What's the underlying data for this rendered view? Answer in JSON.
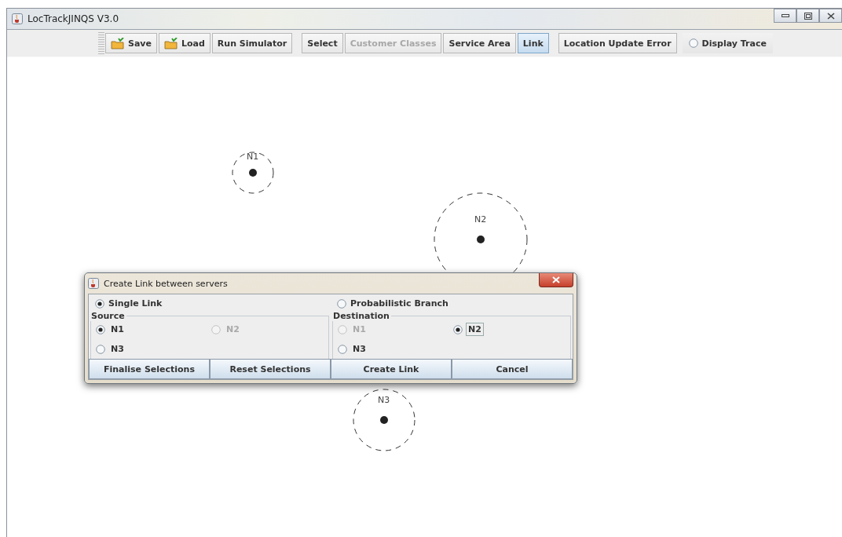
{
  "window": {
    "title": "LocTrackJINQS V3.0"
  },
  "toolbar": [
    {
      "kind": "button",
      "label": "Save",
      "icon": true,
      "selected": false,
      "disabled": false
    },
    {
      "kind": "button",
      "label": "Load",
      "icon": true,
      "selected": false,
      "disabled": false
    },
    {
      "kind": "button",
      "label": "Run Simulator",
      "icon": false,
      "selected": false,
      "disabled": false
    },
    {
      "kind": "separator"
    },
    {
      "kind": "button",
      "label": "Select",
      "icon": false,
      "selected": false,
      "disabled": false
    },
    {
      "kind": "button",
      "label": "Customer Classes",
      "icon": false,
      "selected": false,
      "disabled": true
    },
    {
      "kind": "button",
      "label": "Service Area",
      "icon": false,
      "selected": false,
      "disabled": false
    },
    {
      "kind": "button",
      "label": "Link",
      "icon": false,
      "selected": true,
      "disabled": false
    },
    {
      "kind": "separator"
    },
    {
      "kind": "button",
      "label": "Location Update Error",
      "icon": false,
      "selected": false,
      "disabled": false
    },
    {
      "kind": "radio",
      "label": "Display Trace",
      "selected": false,
      "disabled": false
    }
  ],
  "canvas": {
    "nodes": [
      {
        "label": "N1"
      },
      {
        "label": "N2"
      },
      {
        "label": "N3"
      }
    ]
  },
  "dialog": {
    "title": "Create Link between servers",
    "modes": [
      {
        "label": "Single Link",
        "selected": true
      },
      {
        "label": "Probabilistic Branch",
        "selected": false
      }
    ],
    "groups": [
      {
        "title": "Source",
        "options": [
          {
            "label": "N1",
            "selected": true,
            "disabled": false,
            "focused": false
          },
          {
            "label": "N2",
            "selected": false,
            "disabled": true,
            "focused": false
          },
          {
            "label": "N3",
            "selected": false,
            "disabled": false,
            "focused": false
          }
        ]
      },
      {
        "title": "Destination",
        "options": [
          {
            "label": "N1",
            "selected": false,
            "disabled": true,
            "focused": false
          },
          {
            "label": "N2",
            "selected": true,
            "disabled": false,
            "focused": true
          },
          {
            "label": "N3",
            "selected": false,
            "disabled": false,
            "focused": false
          }
        ]
      }
    ],
    "buttons": [
      "Finalise Selections",
      "Reset Selections",
      "Create Link",
      "Cancel"
    ]
  }
}
